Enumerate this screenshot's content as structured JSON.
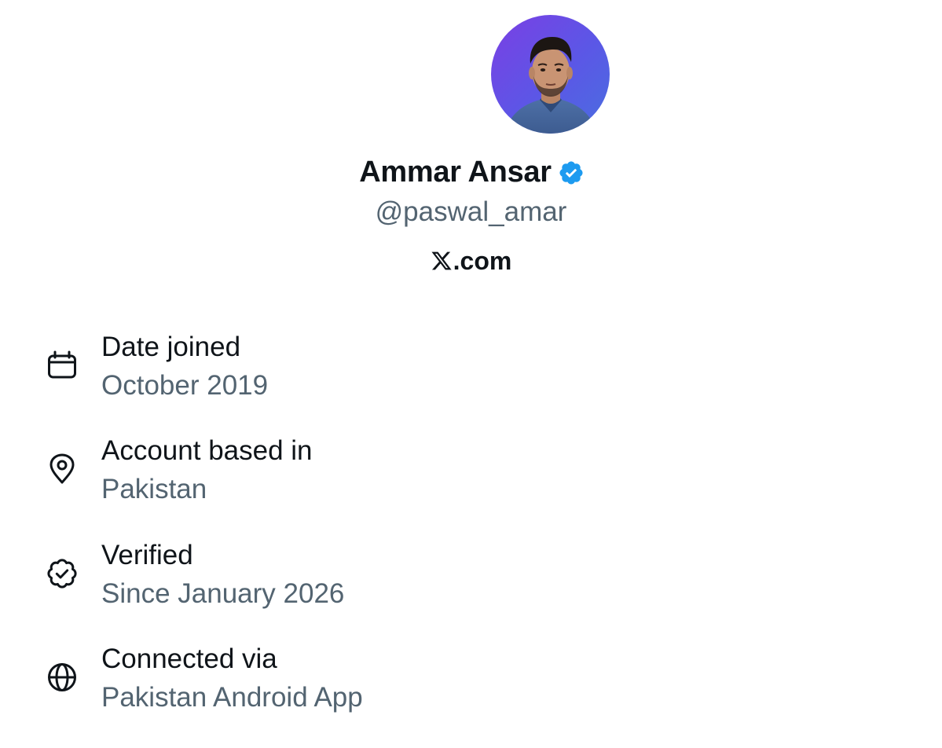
{
  "profile": {
    "display_name": "Ammar Ansar",
    "handle": "@paswal_amar",
    "site": ".com",
    "avatar_icon": "person-avatar-photo",
    "verified_icon": "verified-badge-icon",
    "site_icon": "x-logo-icon"
  },
  "info": {
    "items": [
      {
        "icon": "calendar-icon",
        "label": "Date joined",
        "value": "October 2019"
      },
      {
        "icon": "location-pin-icon",
        "label": "Account based in",
        "value": "Pakistan"
      },
      {
        "icon": "verified-check-icon",
        "label": "Verified",
        "value": "Since January 2026"
      },
      {
        "icon": "globe-icon",
        "label": "Connected via",
        "value": "Pakistan Android App"
      }
    ]
  },
  "colors": {
    "text_primary": "#0f1419",
    "text_secondary": "#536471",
    "verified_blue": "#1d9bf0",
    "avatar_background": "#6a4ae5"
  }
}
